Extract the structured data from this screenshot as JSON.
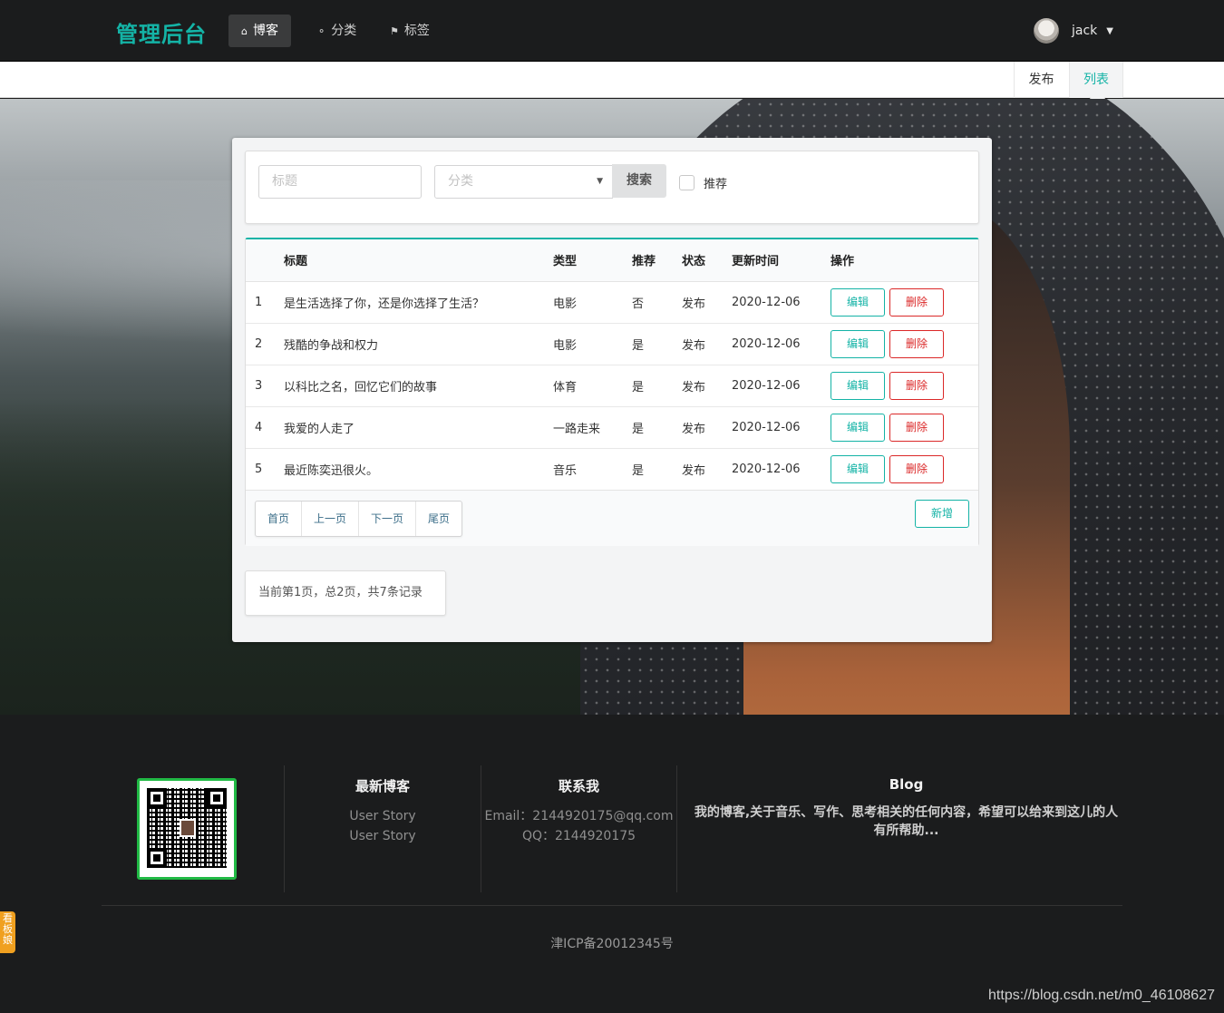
{
  "nav": {
    "brand": "管理后台",
    "items": [
      {
        "label": "博客",
        "icon": "home-icon",
        "active": true
      },
      {
        "label": "分类",
        "icon": "idea-icon",
        "active": false
      },
      {
        "label": "标签",
        "icon": "tags-icon",
        "active": false
      }
    ],
    "user": {
      "name": "jack"
    }
  },
  "submenu": {
    "publish": "发布",
    "list": "列表"
  },
  "search": {
    "title_placeholder": "标题",
    "category_placeholder": "分类",
    "search_label": "搜索",
    "recommend_label": "推荐"
  },
  "table": {
    "headers": [
      "",
      "标题",
      "类型",
      "推荐",
      "状态",
      "更新时间",
      "操作"
    ],
    "rows": [
      {
        "id": "1",
        "title": "是生活选择了你，还是你选择了生活？",
        "type": "电影",
        "recommend": "否",
        "status": "发布",
        "updated": "2020-12-06"
      },
      {
        "id": "2",
        "title": "残酷的争战和权力",
        "type": "电影",
        "recommend": "是",
        "status": "发布",
        "updated": "2020-12-06"
      },
      {
        "id": "3",
        "title": "以科比之名，回忆它们的故事",
        "type": "体育",
        "recommend": "是",
        "status": "发布",
        "updated": "2020-12-06"
      },
      {
        "id": "4",
        "title": "我爱的人走了",
        "type": "一路走来",
        "recommend": "是",
        "status": "发布",
        "updated": "2020-12-06"
      },
      {
        "id": "5",
        "title": "最近陈奕迅很火。",
        "type": "音乐",
        "recommend": "是",
        "status": "发布",
        "updated": "2020-12-06"
      }
    ],
    "edit_label": "编辑",
    "delete_label": "删除",
    "pager": [
      "首页",
      "上一页",
      "下一页",
      "尾页"
    ],
    "add_label": "新增"
  },
  "page_info": "当前第1页，总2页，共7条记录",
  "footer": {
    "latest": {
      "title": "最新博客",
      "items": [
        "User Story",
        "User Story"
      ]
    },
    "contact": {
      "title": "联系我",
      "email": "Email：2144920175@qq.com",
      "qq": "QQ：2144920175"
    },
    "blog": {
      "title": "Blog",
      "text": "我的博客,关于音乐、写作、思考相关的任何内容，希望可以给来到这儿的人有所帮助..."
    },
    "icp": "津ICP备20012345号"
  },
  "watermark": "https://blog.csdn.net/m0_46108627",
  "side_tab": "看板娘",
  "colors": {
    "accent": "#14b3a6",
    "danger": "#db2828",
    "nav_bg": "#1b1c1d",
    "qr_border": "#21ba45"
  }
}
